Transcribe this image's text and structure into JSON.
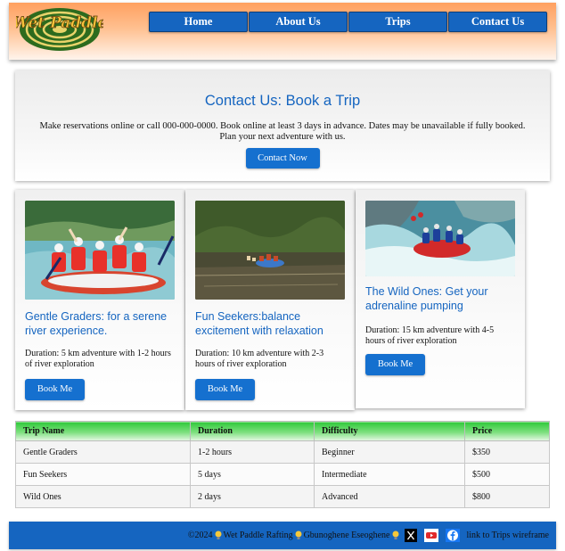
{
  "header": {
    "logo_text": "Wet Paddle",
    "nav": [
      "Home",
      "About Us",
      "Trips",
      "Contact Us"
    ]
  },
  "contact": {
    "title": "Contact Us: Book a Trip",
    "text": "Make reservations online or call 000-000-0000. Book online at least 3 days in advance. Dates may be unavailable if fully booked. Plan your next adventure with us.",
    "button": "Contact Now"
  },
  "cards": [
    {
      "title": "Gentle Graders: for a serene river experience.",
      "text": "Duration: 5 km adventure with 1-2 hours of river exploration",
      "button": "Book Me",
      "image": "raft-photo"
    },
    {
      "title": "Fun Seekers:balance excitement with relaxation",
      "text": "Duration: 10 km adventure with 2-3 hours of river exploration",
      "button": "Book Me",
      "image": "raft-photo"
    },
    {
      "title": "The Wild Ones: Get your adrenaline pumping",
      "text": "Duration: 15 km adventure with 4-5 hours of river exploration",
      "button": "Book Me",
      "image": "raft-photo"
    }
  ],
  "table": {
    "headers": [
      "Trip Name",
      "Duration",
      "Difficulty",
      "Price"
    ],
    "rows": [
      [
        "Gentle Graders",
        "1-2 hours",
        "Beginner",
        "$350"
      ],
      [
        "Fun Seekers",
        "5 days",
        "Intermediate",
        "$500"
      ],
      [
        "Wild Ones",
        "2 days",
        "Advanced",
        "$800"
      ]
    ]
  },
  "footer": {
    "copyright": "©2024",
    "company": "Wet Paddle Rafting",
    "author": "Gbunoghene Eseoghene",
    "link": "link to Trips wireframe",
    "icons": [
      "x-icon",
      "youtube-icon",
      "facebook-icon"
    ]
  },
  "colors": {
    "brand_blue": "#1565c0",
    "header_orange": "#ffa060",
    "table_header_green": "#2fc93a"
  }
}
